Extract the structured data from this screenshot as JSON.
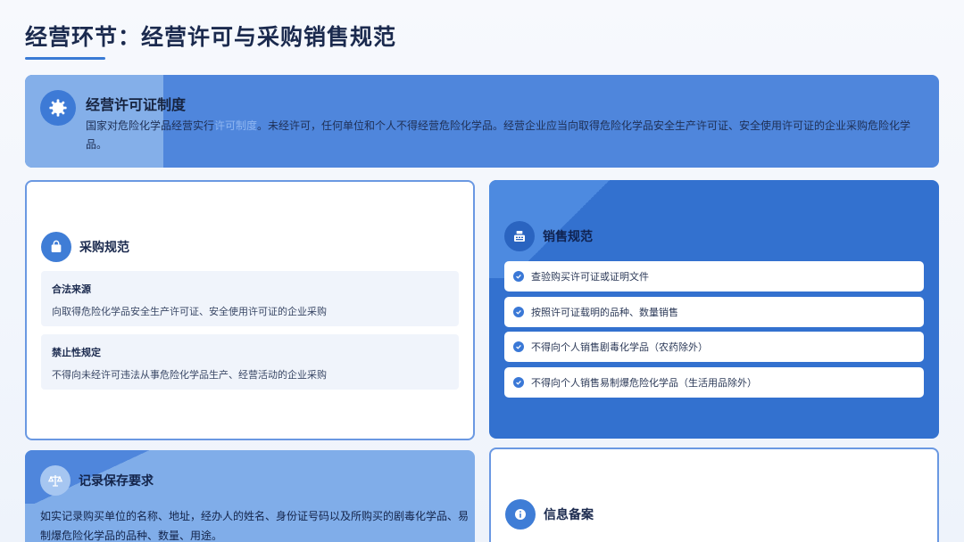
{
  "page": {
    "title": "经营环节：经营许可与采购销售规范"
  },
  "banner": {
    "icon": "gear-badge-icon",
    "title": "经营许可证制度",
    "desc_before": "国家对危险化学品经营实行",
    "desc_highlight": "许可制度",
    "desc_after": "。未经许可，任何单位和个人不得经营危险化学品。经营企业应当向取得危险化学品安全生产许可证、安全使用许可证的企业采购危险化学品。"
  },
  "purchase": {
    "icon": "shopping-bag-icon",
    "title": "采购规范",
    "items": [
      {
        "title": "合法来源",
        "desc": "向取得危险化学品安全生产许可证、安全使用许可证的企业采购"
      },
      {
        "title": "禁止性规定",
        "desc": "不得向未经许可违法从事危险化学品生产、经营活动的企业采购"
      }
    ]
  },
  "sales": {
    "icon": "cash-register-icon",
    "title": "销售规范",
    "items": [
      "查验购买许可证或证明文件",
      "按照许可证载明的品种、数量销售",
      "不得向个人销售剧毒化学品（农药除外）",
      "不得向个人销售易制爆危险化学品（生活用品除外）"
    ]
  },
  "record": {
    "icon": "scale-icon",
    "title": "记录保存要求",
    "desc": "如实记录购买单位的名称、地址，经办人的姓名、身份证号码以及所购买的剧毒化学品、易制爆危险化学品的品种、数量、用途。"
  },
  "filing": {
    "icon": "info-icon",
    "title": "信息备案"
  },
  "colors": {
    "accent": "#3a7bd5",
    "banner": "#4f86dc",
    "sales": "#3371cf"
  }
}
